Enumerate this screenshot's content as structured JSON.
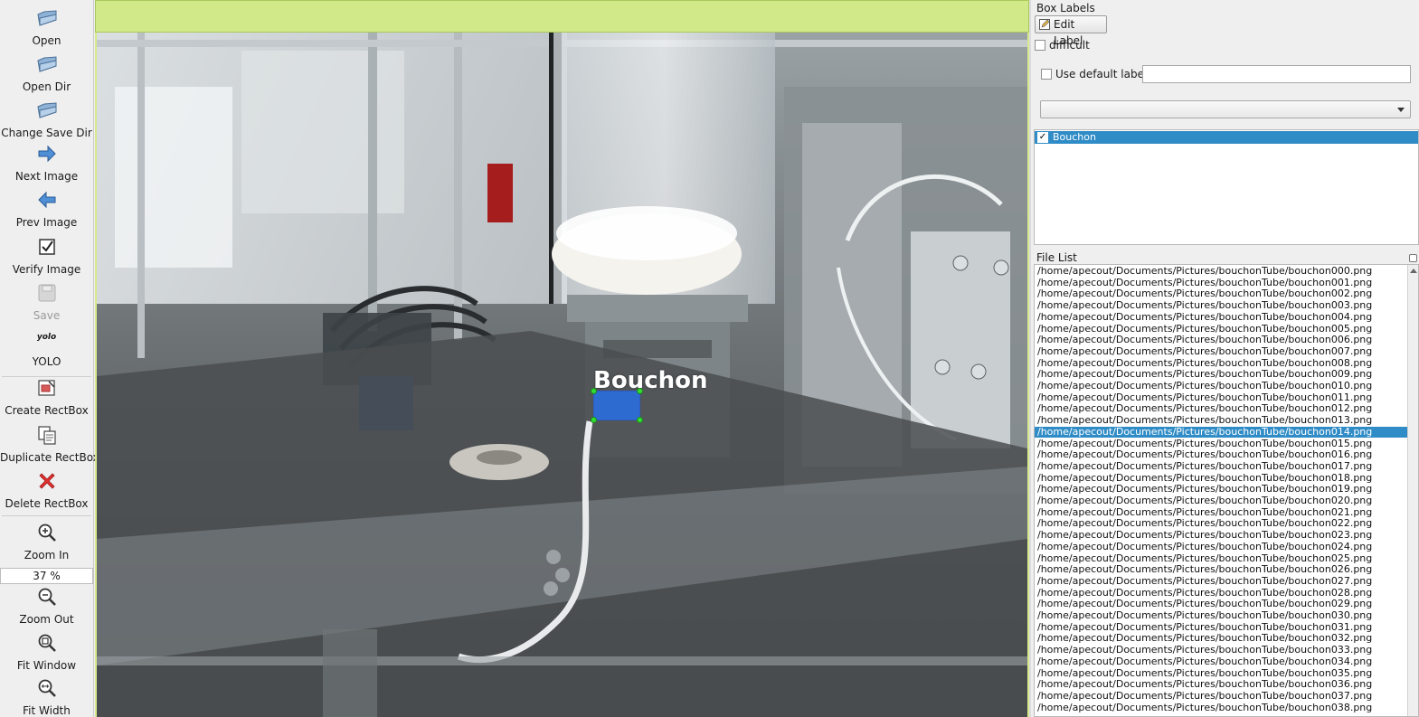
{
  "toolbar": {
    "open": "Open",
    "open_dir": "Open Dir",
    "change_save_dir": "Change Save Dir",
    "next_image": "Next Image",
    "prev_image": "Prev Image",
    "verify_image": "Verify Image",
    "save": "Save",
    "yolo_icon_text": "yolo",
    "yolo": "YOLO",
    "create_rectbox": "Create RectBox",
    "duplicate_rectbox": "Duplicate RectBox",
    "delete_rectbox": "Delete RectBox",
    "zoom_in": "Zoom In",
    "zoom_value": "37 %",
    "zoom_out": "Zoom Out",
    "fit_window": "Fit Window",
    "fit_width": "Fit Width"
  },
  "canvas": {
    "box_label": "Bouchon",
    "accent_color": "#d2e98a",
    "box_color": "#2a6ee6"
  },
  "box_labels_panel": {
    "title": "Box Labels",
    "edit_label": "Edit Label",
    "difficult": "difficult",
    "use_default_label": "Use default label",
    "default_label_value": "",
    "combo_value": "",
    "labels": [
      {
        "name": "Bouchon",
        "checked": true,
        "selected": true
      }
    ]
  },
  "file_list_panel": {
    "title": "File List",
    "selected_index": 14,
    "files": [
      "/home/apecout/Documents/Pictures/bouchonTube/bouchon000.png",
      "/home/apecout/Documents/Pictures/bouchonTube/bouchon001.png",
      "/home/apecout/Documents/Pictures/bouchonTube/bouchon002.png",
      "/home/apecout/Documents/Pictures/bouchonTube/bouchon003.png",
      "/home/apecout/Documents/Pictures/bouchonTube/bouchon004.png",
      "/home/apecout/Documents/Pictures/bouchonTube/bouchon005.png",
      "/home/apecout/Documents/Pictures/bouchonTube/bouchon006.png",
      "/home/apecout/Documents/Pictures/bouchonTube/bouchon007.png",
      "/home/apecout/Documents/Pictures/bouchonTube/bouchon008.png",
      "/home/apecout/Documents/Pictures/bouchonTube/bouchon009.png",
      "/home/apecout/Documents/Pictures/bouchonTube/bouchon010.png",
      "/home/apecout/Documents/Pictures/bouchonTube/bouchon011.png",
      "/home/apecout/Documents/Pictures/bouchonTube/bouchon012.png",
      "/home/apecout/Documents/Pictures/bouchonTube/bouchon013.png",
      "/home/apecout/Documents/Pictures/bouchonTube/bouchon014.png",
      "/home/apecout/Documents/Pictures/bouchonTube/bouchon015.png",
      "/home/apecout/Documents/Pictures/bouchonTube/bouchon016.png",
      "/home/apecout/Documents/Pictures/bouchonTube/bouchon017.png",
      "/home/apecout/Documents/Pictures/bouchonTube/bouchon018.png",
      "/home/apecout/Documents/Pictures/bouchonTube/bouchon019.png",
      "/home/apecout/Documents/Pictures/bouchonTube/bouchon020.png",
      "/home/apecout/Documents/Pictures/bouchonTube/bouchon021.png",
      "/home/apecout/Documents/Pictures/bouchonTube/bouchon022.png",
      "/home/apecout/Documents/Pictures/bouchonTube/bouchon023.png",
      "/home/apecout/Documents/Pictures/bouchonTube/bouchon024.png",
      "/home/apecout/Documents/Pictures/bouchonTube/bouchon025.png",
      "/home/apecout/Documents/Pictures/bouchonTube/bouchon026.png",
      "/home/apecout/Documents/Pictures/bouchonTube/bouchon027.png",
      "/home/apecout/Documents/Pictures/bouchonTube/bouchon028.png",
      "/home/apecout/Documents/Pictures/bouchonTube/bouchon029.png",
      "/home/apecout/Documents/Pictures/bouchonTube/bouchon030.png",
      "/home/apecout/Documents/Pictures/bouchonTube/bouchon031.png",
      "/home/apecout/Documents/Pictures/bouchonTube/bouchon032.png",
      "/home/apecout/Documents/Pictures/bouchonTube/bouchon033.png",
      "/home/apecout/Documents/Pictures/bouchonTube/bouchon034.png",
      "/home/apecout/Documents/Pictures/bouchonTube/bouchon035.png",
      "/home/apecout/Documents/Pictures/bouchonTube/bouchon036.png",
      "/home/apecout/Documents/Pictures/bouchonTube/bouchon037.png",
      "/home/apecout/Documents/Pictures/bouchonTube/bouchon038.png"
    ]
  }
}
